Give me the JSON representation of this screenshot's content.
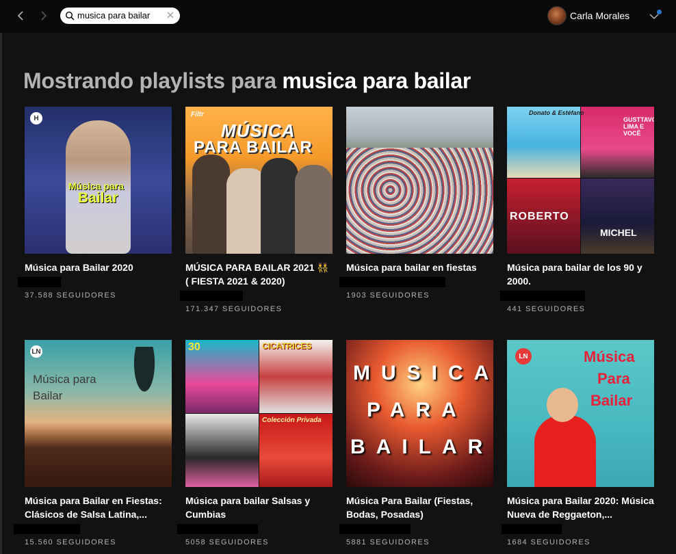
{
  "search": {
    "query": "musica para bailar"
  },
  "user": {
    "name": "Carla Morales"
  },
  "heading": {
    "prefix": "Mostrando playlists para ",
    "query": "musica para bailar"
  },
  "playlists": [
    {
      "title": "Música para Bailar 2020",
      "followers": "37.588 SEGUIDORES",
      "cover_text": [
        "Música para",
        "Bailar"
      ]
    },
    {
      "title": "MÚSICA PARA BAILAR 2021 👯 ( FIESTA 2021 & 2020)",
      "followers": "171.347 SEGUIDORES",
      "cover_text": [
        "MÚSICA",
        "PARA BAILAR",
        "Filtr"
      ]
    },
    {
      "title": "Música para bailar en fiestas",
      "followers": "1903 SEGUIDORES",
      "cover_text": []
    },
    {
      "title": "Música para bailar de los 90 y 2000.",
      "followers": "441 SEGUIDORES",
      "cover_text": [
        "Donato & Estéfano",
        "GUSTTAVO LIMA E VOCÊ",
        "ROBERTO",
        "MICHEL"
      ]
    },
    {
      "title": "Música para Bailar en Fiestas: Clásicos de Salsa Latina,...",
      "followers": "15.560 SEGUIDORES",
      "cover_text": [
        "Música para",
        "Bailar"
      ]
    },
    {
      "title": "Música para bailar Salsas y Cumbias",
      "followers": "5058 SEGUIDORES",
      "cover_text": [
        "CICATRICES",
        "30",
        "Colección Privada"
      ]
    },
    {
      "title": "Música Para Bailar (Fiestas, Bodas, Posadas)",
      "followers": "5881 SEGUIDORES",
      "cover_text": [
        "MUSICA",
        "PARA",
        "BAILAR"
      ]
    },
    {
      "title": "Música para Bailar 2020: Música Nueva de Reggaeton,...",
      "followers": "1684 SEGUIDORES",
      "cover_text": [
        "Música",
        "Para",
        "Bailar"
      ]
    }
  ]
}
